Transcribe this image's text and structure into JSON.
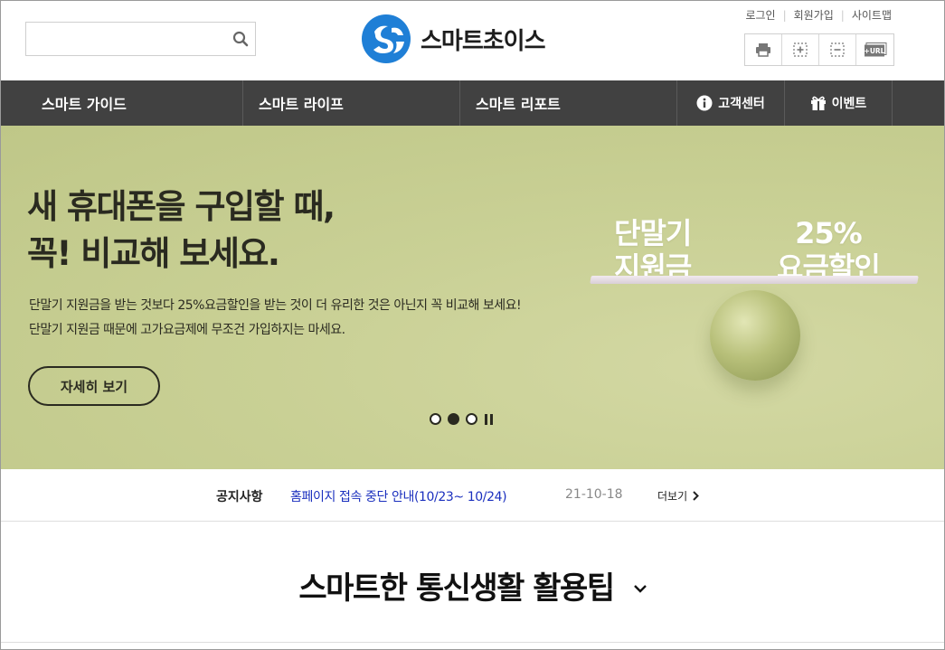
{
  "header": {
    "search": {
      "placeholder": "",
      "value": ""
    },
    "logo_text": "스마트초이스",
    "util_links": [
      "로그인",
      "회원가입",
      "사이트맵"
    ],
    "tools": [
      "print-icon",
      "zoom-in-icon",
      "zoom-out-icon",
      "url-copy-icon"
    ],
    "tool_url_label": "+URL"
  },
  "nav": {
    "main": [
      "스마트 가이드",
      "스마트 라이프",
      "스마트 리포트"
    ],
    "customer_center": "고객센터",
    "event": "이벤트"
  },
  "hero": {
    "title_line1": "새 휴대폰을 구입할 때,",
    "title_line2": "꼭! 비교해 보세요.",
    "desc_line1": "단말기 지원금을 받는 것보다 25%요금할인을 받는 것이 더 유리한 것은 아닌지 꼭 비교해 보세요!",
    "desc_line2": "단말기 지원금 때문에 고가요금제에 무조건 가입하지는 마세요.",
    "button": "자세히 보기",
    "art_left_line1": "단말기",
    "art_left_line2": "지원금",
    "art_right_line1": "25%",
    "art_right_line2": "요금할인",
    "slides_total": 3,
    "slide_active": 2
  },
  "notice": {
    "label": "공지사항",
    "title": "홈페이지 접속 중단 안내(10/23~ 10/24)",
    "date": "21-10-18",
    "more": "더보기"
  },
  "section": {
    "title": "스마트한 통신생활 활용팁"
  },
  "colors": {
    "nav_bg": "#414141",
    "hero_bg": "#c9d095",
    "notice_link": "#1a2fbe",
    "logo_blue": "#1f7fd6"
  }
}
